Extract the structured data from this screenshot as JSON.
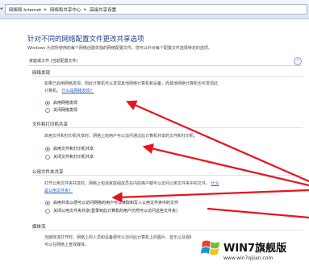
{
  "breadcrumb": {
    "items": [
      "网络和 Internet",
      "网络和共享中心",
      "高级共享设置"
    ],
    "separator": "▸"
  },
  "page": {
    "title": "针对不同的网络配置文件更改共享选项",
    "description": "Windows 为您所使用的每个网络创建单独的网络配置文件。您可以针对每个配置文件选择特定的选项。",
    "profile_label": "家庭或工作 (当前配置文件)",
    "collapse_glyph": "⌃"
  },
  "sections": {
    "discovery": {
      "heading": "网络发现",
      "text1": "如果已启用网络发现，则此计算机可以发现其他网络计算机和设备，而其他网络计算机也可发现此",
      "text2": "计算机。",
      "link": "什么是网络发现？",
      "options": [
        "启用网络发现",
        "关闭网络发现"
      ],
      "selected": 0
    },
    "file_printer": {
      "heading": "文件和打印机共享",
      "text1": "启用文件和打印机共享时，网络上的用户可以访问通过此计算机共享的文件和打印机。",
      "options": [
        "启用文件和打印机共享",
        "关闭文件和打印机共享"
      ],
      "selected": 0
    },
    "public_folder": {
      "heading": "公用文件夹共享",
      "text1": "打开公用文件夹共享时，网络上包括家庭组成员在内的用户都可以访问公用文件夹中的文件。",
      "link_prefix": "什么",
      "link": "是公用文件夹？",
      "options": [
        "启用共享以便可以访问网络的用户可以读取和写入公用文件夹中的文件",
        "关闭公用文件夹共享(登录到此计算机的用户仍然可以访问这些文件夹)"
      ],
      "selected": 0
    },
    "media": {
      "heading": "媒体流",
      "text1": "当媒体流打开时，网络上的人员和设备便可以访问此计算机上的图片、音乐以及视频。该计算机还",
      "text2": "可以在网络上查找媒体。"
    }
  },
  "watermark": {
    "title": "WIN7旗舰版",
    "url": "www.win7qijian.com"
  },
  "colors": {
    "arrow": "#e8141c",
    "title": "#1e3e91",
    "link": "#1f5fc4"
  }
}
